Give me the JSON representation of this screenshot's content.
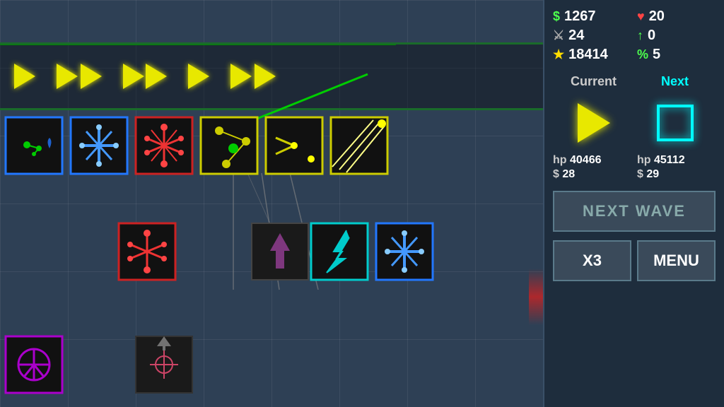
{
  "sidebar": {
    "money": "1267",
    "hearts": "20",
    "sword": "24",
    "arrow_up": "0",
    "stars": "18414",
    "percent": "5",
    "current_label": "Current",
    "next_label": "Next",
    "current_hp_label": "hp",
    "current_hp": "40466",
    "current_cost_label": "$",
    "current_cost": "28",
    "next_hp_label": "hp",
    "next_hp": "45112",
    "next_cost_label": "$",
    "next_cost": "29",
    "next_wave_btn": "NEXT WAVE",
    "x3_btn": "X3",
    "menu_btn": "MENU"
  }
}
